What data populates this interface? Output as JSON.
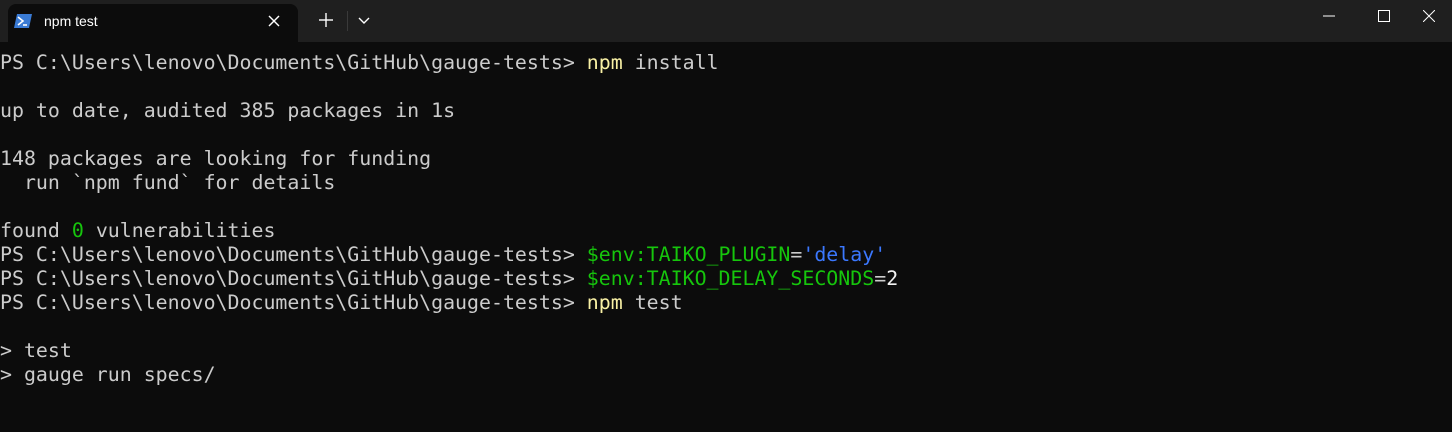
{
  "tab": {
    "title": "npm test",
    "icon": "powershell-icon"
  },
  "colors": {
    "background": "#0c0c0c",
    "titlebar": "#1f1f1f",
    "text": "#cccccc",
    "command": "#f9f1a5",
    "variable": "#16c60c",
    "string": "#3b78ff"
  },
  "terminal": {
    "prompt": "PS C:\\Users\\lenovo\\Documents\\GitHub\\gauge-tests> ",
    "lines": {
      "l1_cmd": "npm",
      "l1_arg": " install",
      "l3": "up to date, audited 385 packages in 1s",
      "l5": "148 packages are looking for funding",
      "l6": "  run `npm fund` for details",
      "l8_a": "found ",
      "l8_b": "0",
      "l8_c": " vulnerabilities",
      "l9_var": "$env:TAIKO_PLUGIN",
      "l9_eq": "=",
      "l9_val": "'delay'",
      "l10_var": "$env:TAIKO_DELAY_SECONDS",
      "l10_eq": "=",
      "l10_val": "2",
      "l11_cmd": "npm",
      "l11_arg": " test",
      "l13": "> test",
      "l14": "> gauge run specs/"
    }
  }
}
